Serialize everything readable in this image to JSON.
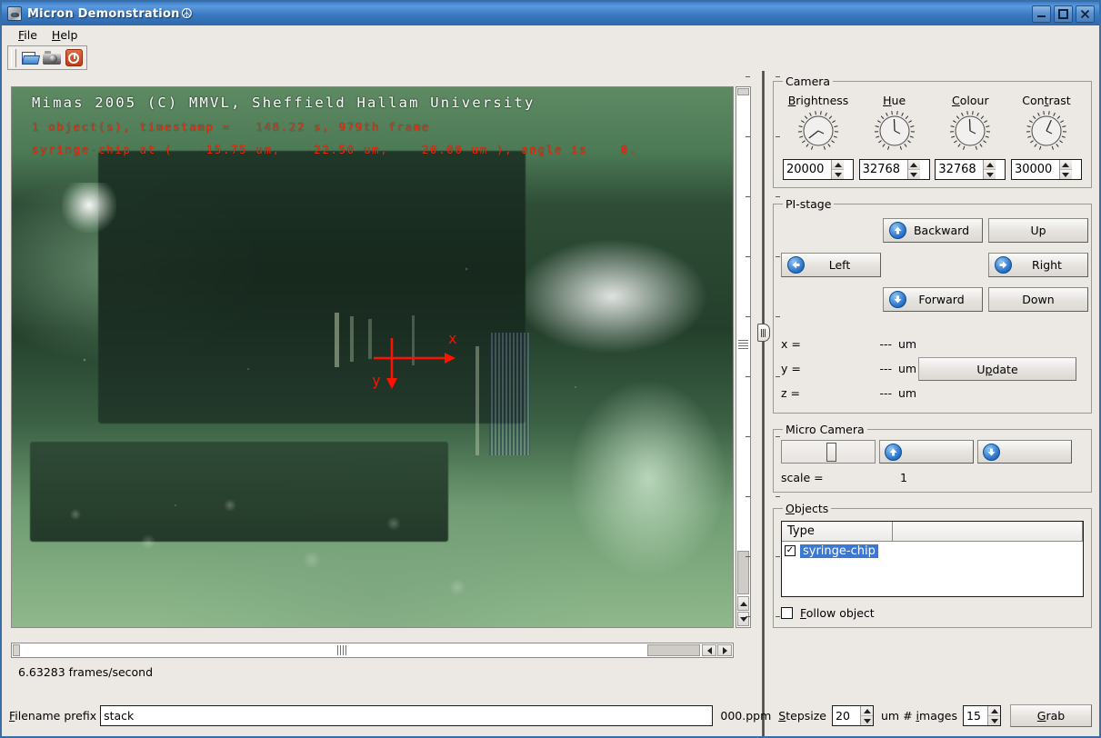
{
  "window": {
    "title": "Micron Demonstration",
    "title_glyph": "☮",
    "minimize": "minimize-icon",
    "maximize": "maximize-icon",
    "close": "close-icon"
  },
  "menu": {
    "items": [
      {
        "label": "File",
        "mnemonic": "F"
      },
      {
        "label": "Help",
        "mnemonic": "H"
      }
    ]
  },
  "toolbar": {
    "buttons": [
      {
        "name": "open-file-button",
        "icon": "open-folder-icon"
      },
      {
        "name": "grab-image-button",
        "icon": "camera-icon"
      },
      {
        "name": "quit-button",
        "icon": "power-icon"
      }
    ]
  },
  "video": {
    "overlay_title": "Mimas 2005 (C) MMVL, Sheffield Hallam University",
    "overlay_line2": "1 object(s), timestamp =   148.22 s, 979th frame",
    "overlay_line3": "syringe-chip at (   -15.75 um,   -22.50 um,    20.00 um ), angle is    0.",
    "axis_x_label": "x",
    "axis_y_label": "y",
    "overlay_title_color": "#ffffff",
    "overlay_text_color": "#f22a0e"
  },
  "status": {
    "fps": "6.63283 frames/second"
  },
  "bottom": {
    "filename_prefix_label": "Filename prefix",
    "filename_prefix_mnemonic": "F",
    "filename_prefix_value": "stack",
    "ppm_label": "000.ppm",
    "stepsize_label": "Stepsize",
    "stepsize_mnemonic": "S",
    "stepsize_value": "20",
    "um_label": "um # ",
    "images_label": "images",
    "images_mnemonic": "i",
    "images_value": "15",
    "grab_label": "Grab",
    "grab_mnemonic": "G"
  },
  "camera": {
    "legend": "Camera",
    "controls": [
      {
        "label": "Brightness",
        "mnemonic": "B",
        "value": "20000",
        "dial_angle": -128
      },
      {
        "label": "Hue",
        "mnemonic": "H",
        "value": "32768",
        "dial_angle": -2
      },
      {
        "label": "Colour",
        "mnemonic": "C",
        "value": "32768",
        "dial_angle": -2
      },
      {
        "label": "Contrast",
        "mnemonic": "t",
        "value": "30000",
        "dial_angle": 24
      }
    ]
  },
  "pistage": {
    "legend": "PI-stage",
    "buttons": {
      "backward": "Backward",
      "up": "Up",
      "left": "Left",
      "right": "Right",
      "forward": "Forward",
      "down": "Down",
      "update": "Update",
      "update_mnemonic": "p"
    },
    "coords": [
      {
        "axis": "x =",
        "value": "---",
        "unit": "um"
      },
      {
        "axis": "y =",
        "value": "---",
        "unit": "um"
      },
      {
        "axis": "z =",
        "value": "---",
        "unit": "um"
      }
    ]
  },
  "microcamera": {
    "legend": "Micro Camera",
    "up_button": "micro-camera-up-icon",
    "down_button": "micro-camera-down-icon",
    "scale_label": "scale =",
    "scale_value": "1"
  },
  "objects": {
    "legend": "Objects",
    "legend_mnemonic": "O",
    "columns": [
      "Type",
      ""
    ],
    "rows": [
      {
        "checked": true,
        "type": "syringe-chip",
        "selected": true
      }
    ],
    "follow_label": "Follow object",
    "follow_mnemonic": "F",
    "follow_checked": false
  },
  "colors": {
    "titlebar_blue": "#3a79c1",
    "selection_blue": "#3a78d2",
    "panel_gray": "#ece9e5",
    "overlay_red": "#f22a0e"
  }
}
